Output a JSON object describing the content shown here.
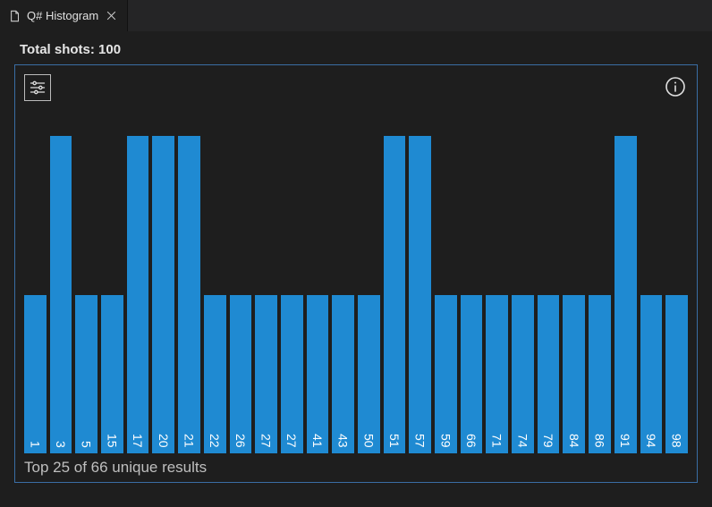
{
  "tab": {
    "title": "Q# Histogram"
  },
  "total_shots_label": "Total shots: 100",
  "caption": "Top 25 of 66 unique results",
  "chart_data": {
    "type": "bar",
    "title": "",
    "xlabel": "",
    "ylabel": "",
    "ylim": [
      0,
      2.2
    ],
    "categories": [
      "1",
      "3",
      "5",
      "15",
      "17",
      "20",
      "21",
      "22",
      "26",
      "27",
      "27",
      "41",
      "43",
      "50",
      "51",
      "57",
      "59",
      "66",
      "71",
      "74",
      "79",
      "84",
      "86",
      "91",
      "94",
      "98"
    ],
    "values": [
      1,
      2,
      1,
      1,
      2,
      2,
      2,
      1,
      1,
      1,
      1,
      1,
      1,
      1,
      2,
      2,
      1,
      1,
      1,
      1,
      1,
      1,
      1,
      2,
      1,
      1
    ]
  }
}
